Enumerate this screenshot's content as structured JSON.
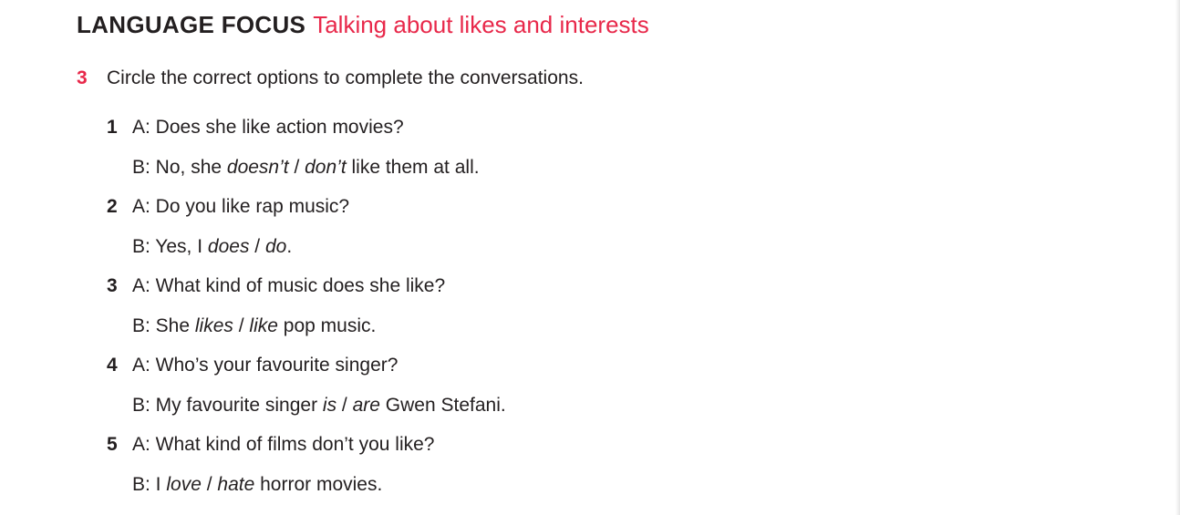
{
  "heading": {
    "title": "LANGUAGE FOCUS",
    "subtitle": "Talking about likes and interests"
  },
  "exercise": {
    "number": "3",
    "instruction": "Circle the correct options to complete the conversations."
  },
  "items": [
    {
      "number": "1",
      "a": "A: Does she like action movies?",
      "b_before": "B: No, she ",
      "b_opt1": "doesn’t",
      "b_sep": " / ",
      "b_opt2": "don’t",
      "b_after": " like them at all."
    },
    {
      "number": "2",
      "a": "A: Do you like rap music?",
      "b_before": "B: Yes, I ",
      "b_opt1": "does",
      "b_sep": " / ",
      "b_opt2": "do",
      "b_after": "."
    },
    {
      "number": "3",
      "a": "A: What kind of music does she like?",
      "b_before": "B: She ",
      "b_opt1": "likes",
      "b_sep": " / ",
      "b_opt2": "like",
      "b_after": " pop music."
    },
    {
      "number": "4",
      "a": "A: Who’s your favourite singer?",
      "b_before": "B: My favourite singer ",
      "b_opt1": "is",
      "b_sep": " / ",
      "b_opt2": "are",
      "b_after": " Gwen Stefani."
    },
    {
      "number": "5",
      "a": "A: What kind of films don’t you like?",
      "b_before": "B: I ",
      "b_opt1": "love",
      "b_sep": " / ",
      "b_opt2": "hate",
      "b_after": " horror movies."
    }
  ],
  "colors": {
    "accent": "#e8284a",
    "text": "#231f20"
  }
}
